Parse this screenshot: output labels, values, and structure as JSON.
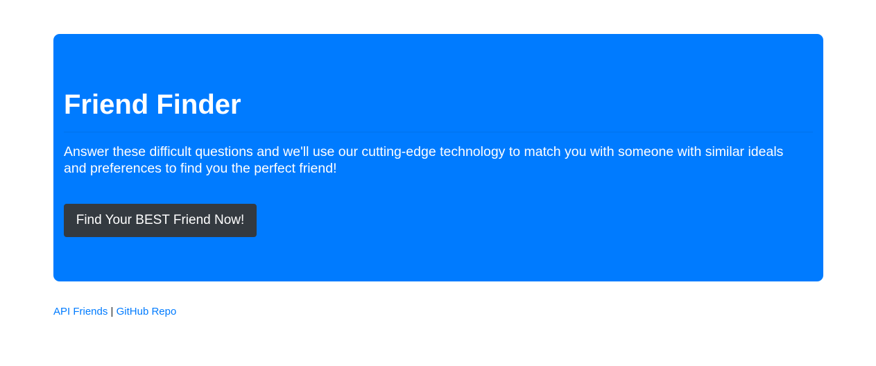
{
  "hero": {
    "title": "Friend Finder",
    "lead": "Answer these difficult questions and we'll use our cutting-edge technology to match you with someone with similar ideals and preferences to find you the perfect friend!",
    "button_label": "Find Your BEST Friend Now!"
  },
  "footer": {
    "link_api": "API Friends",
    "separator": "|",
    "link_github": "GitHub Repo"
  },
  "colors": {
    "hero_background": "#007bff",
    "button_background": "#343a40",
    "link": "#007bff"
  }
}
